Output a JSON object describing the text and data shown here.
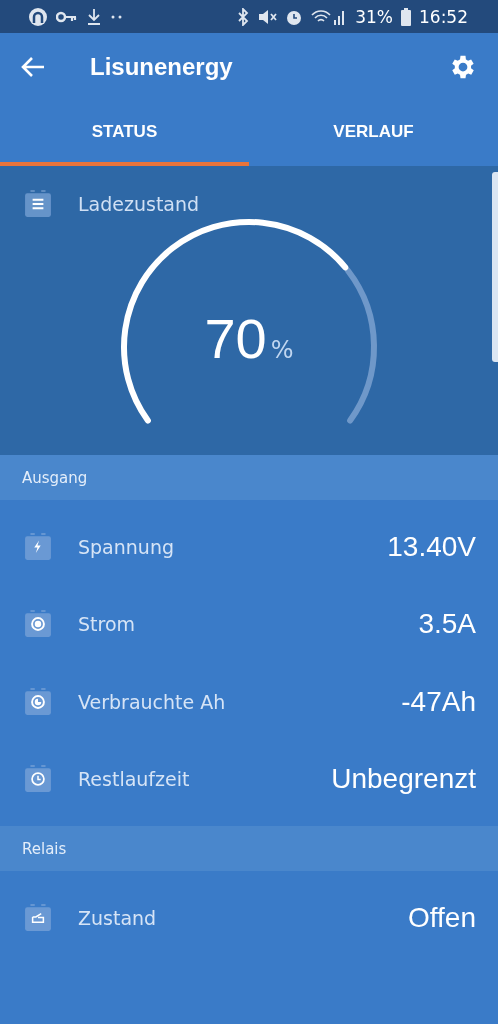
{
  "status_bar": {
    "battery": "31%",
    "time": "16:52"
  },
  "app_bar": {
    "title": "Lisunenergy"
  },
  "tabs": [
    {
      "label": "STATUS",
      "selected": true
    },
    {
      "label": "VERLAUF",
      "selected": false
    }
  ],
  "gauge": {
    "label": "Ladezustand",
    "value": "70",
    "unit": "%"
  },
  "sections": [
    {
      "title": "Ausgang",
      "rows": [
        {
          "kind": "voltage",
          "label": "Spannung",
          "value": "13.40V"
        },
        {
          "kind": "current",
          "label": "Strom",
          "value": "3.5A"
        },
        {
          "kind": "consumed",
          "label": "Verbrauchte Ah",
          "value": "-47Ah"
        },
        {
          "kind": "time",
          "label": "Restlaufzeit",
          "value": "Unbegrenzt"
        }
      ]
    },
    {
      "title": "Relais",
      "rows": [
        {
          "kind": "relay",
          "label": "Zustand",
          "value": "Offen"
        }
      ]
    }
  ]
}
